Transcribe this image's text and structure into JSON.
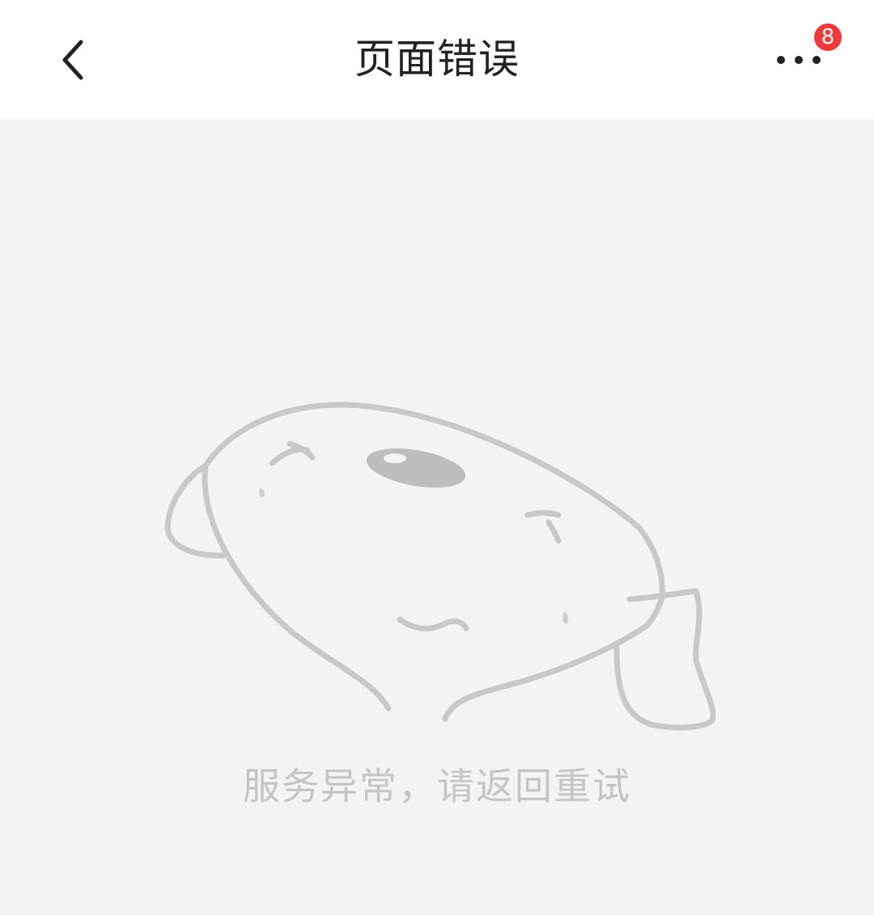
{
  "header": {
    "title": "页面错误",
    "back_icon": "chevron-left-icon",
    "more_icon": "more-horizontal-icon",
    "notification_badge": "8"
  },
  "main": {
    "illustration": "sad-fish-icon",
    "message": "服务异常，请返回重试"
  },
  "colors": {
    "header_background": "#ffffff",
    "page_background": "#f2f3f5",
    "badge": "#ee3a3a",
    "message_text": "#c4c4c4",
    "illustration_stroke": "#c8c8c8"
  }
}
